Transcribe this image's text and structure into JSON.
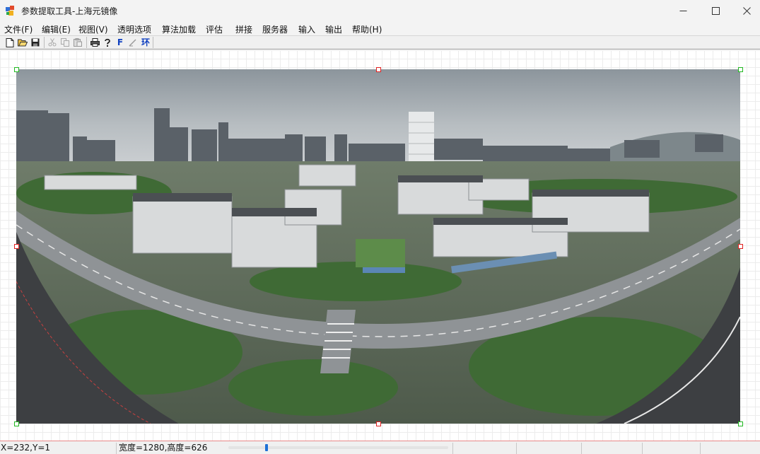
{
  "window": {
    "title": "参数提取工具-上海元镜像",
    "minimize_icon": "minimize-icon",
    "maximize_icon": "maximize-icon",
    "close_icon": "close-icon"
  },
  "menu": [
    {
      "label": "文件(F)"
    },
    {
      "label": "编辑(E)"
    },
    {
      "label": "视图(V)"
    },
    {
      "label": "透明选项"
    },
    {
      "label": "算法加载"
    },
    {
      "label": "评估"
    },
    {
      "label": "拼接"
    },
    {
      "label": "服务器"
    },
    {
      "label": "输入"
    },
    {
      "label": "输出"
    },
    {
      "label": "帮助(H)"
    }
  ],
  "toolbar": {
    "buttons": [
      {
        "icon": "new-file-icon"
      },
      {
        "icon": "open-folder-icon"
      },
      {
        "icon": "save-icon"
      },
      {
        "icon": "cut-icon"
      },
      {
        "icon": "copy-icon"
      },
      {
        "icon": "paste-icon"
      },
      {
        "icon": "print-icon"
      },
      {
        "icon": "help-icon"
      }
    ],
    "text_buttons": [
      {
        "label": "F"
      },
      {
        "label": "环"
      }
    ],
    "pen_icon": "pen-icon"
  },
  "status": {
    "coords": "X=232,Y=1",
    "size": "宽度=1280,高度=626"
  },
  "colors": {
    "handle_corner": "#1fb81f",
    "handle_edge": "#e02020",
    "accent": "#1e70d6"
  }
}
